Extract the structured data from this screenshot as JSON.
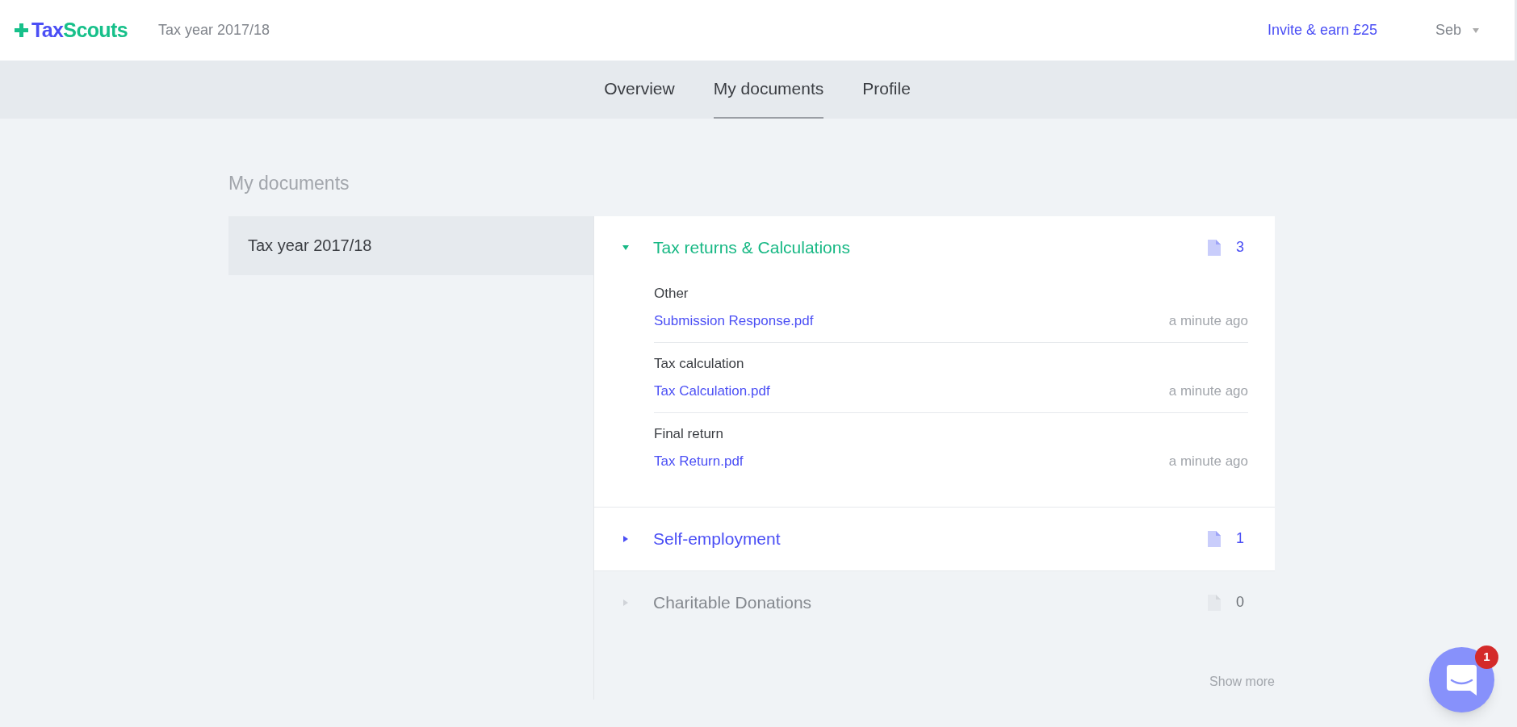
{
  "header": {
    "logo": {
      "first": "Tax",
      "second": "Scouts"
    },
    "tax_year": "Tax year 2017/18",
    "invite_link": "Invite & earn £25",
    "user": "Seb"
  },
  "tabs": [
    {
      "label": "Overview",
      "selected": false
    },
    {
      "label": "My documents",
      "selected": true
    },
    {
      "label": "Profile",
      "selected": false
    }
  ],
  "page_title": "My documents",
  "years": [
    {
      "label": "Tax year 2017/18",
      "selected": true
    }
  ],
  "sections": [
    {
      "title": "Tax returns & Calculations",
      "count": "3",
      "expanded": true,
      "disabled": false,
      "documents": [
        {
          "category": "Other",
          "file": "Submission Response.pdf",
          "time": "a minute ago"
        },
        {
          "category": "Tax calculation",
          "file": "Tax Calculation.pdf",
          "time": "a minute ago"
        },
        {
          "category": "Final return",
          "file": "Tax Return.pdf",
          "time": "a minute ago"
        }
      ]
    },
    {
      "title": "Self-employment",
      "count": "1",
      "expanded": false,
      "disabled": false
    },
    {
      "title": "Charitable Donations",
      "count": "0",
      "expanded": false,
      "disabled": true
    }
  ],
  "show_more": "Show more",
  "chat": {
    "badge": "1"
  }
}
